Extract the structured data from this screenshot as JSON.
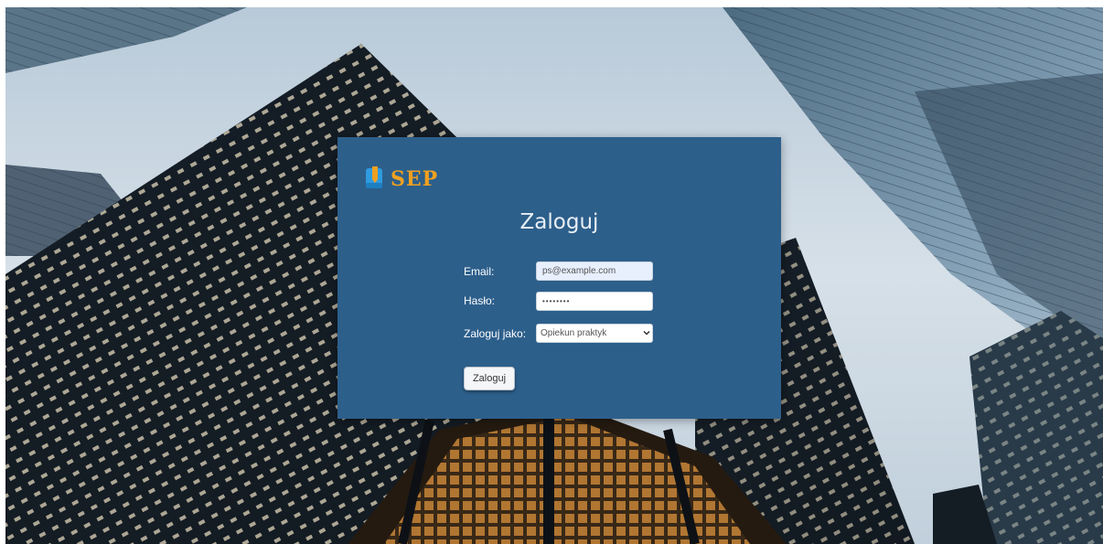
{
  "logo": {
    "text": "SEP",
    "icon": "sep-logo-icon",
    "brand_color": "#f0a020"
  },
  "login": {
    "title": "Zaloguj",
    "email_label": "Email:",
    "email_value": "ps@example.com",
    "password_label": "Hasło:",
    "password_value": "password",
    "role_label": "Zaloguj jako:",
    "role_selected": "Opiekun praktyk",
    "submit_label": "Zaloguj"
  },
  "colors": {
    "card_background": "#2d5f8b",
    "accent": "#f0a020"
  }
}
